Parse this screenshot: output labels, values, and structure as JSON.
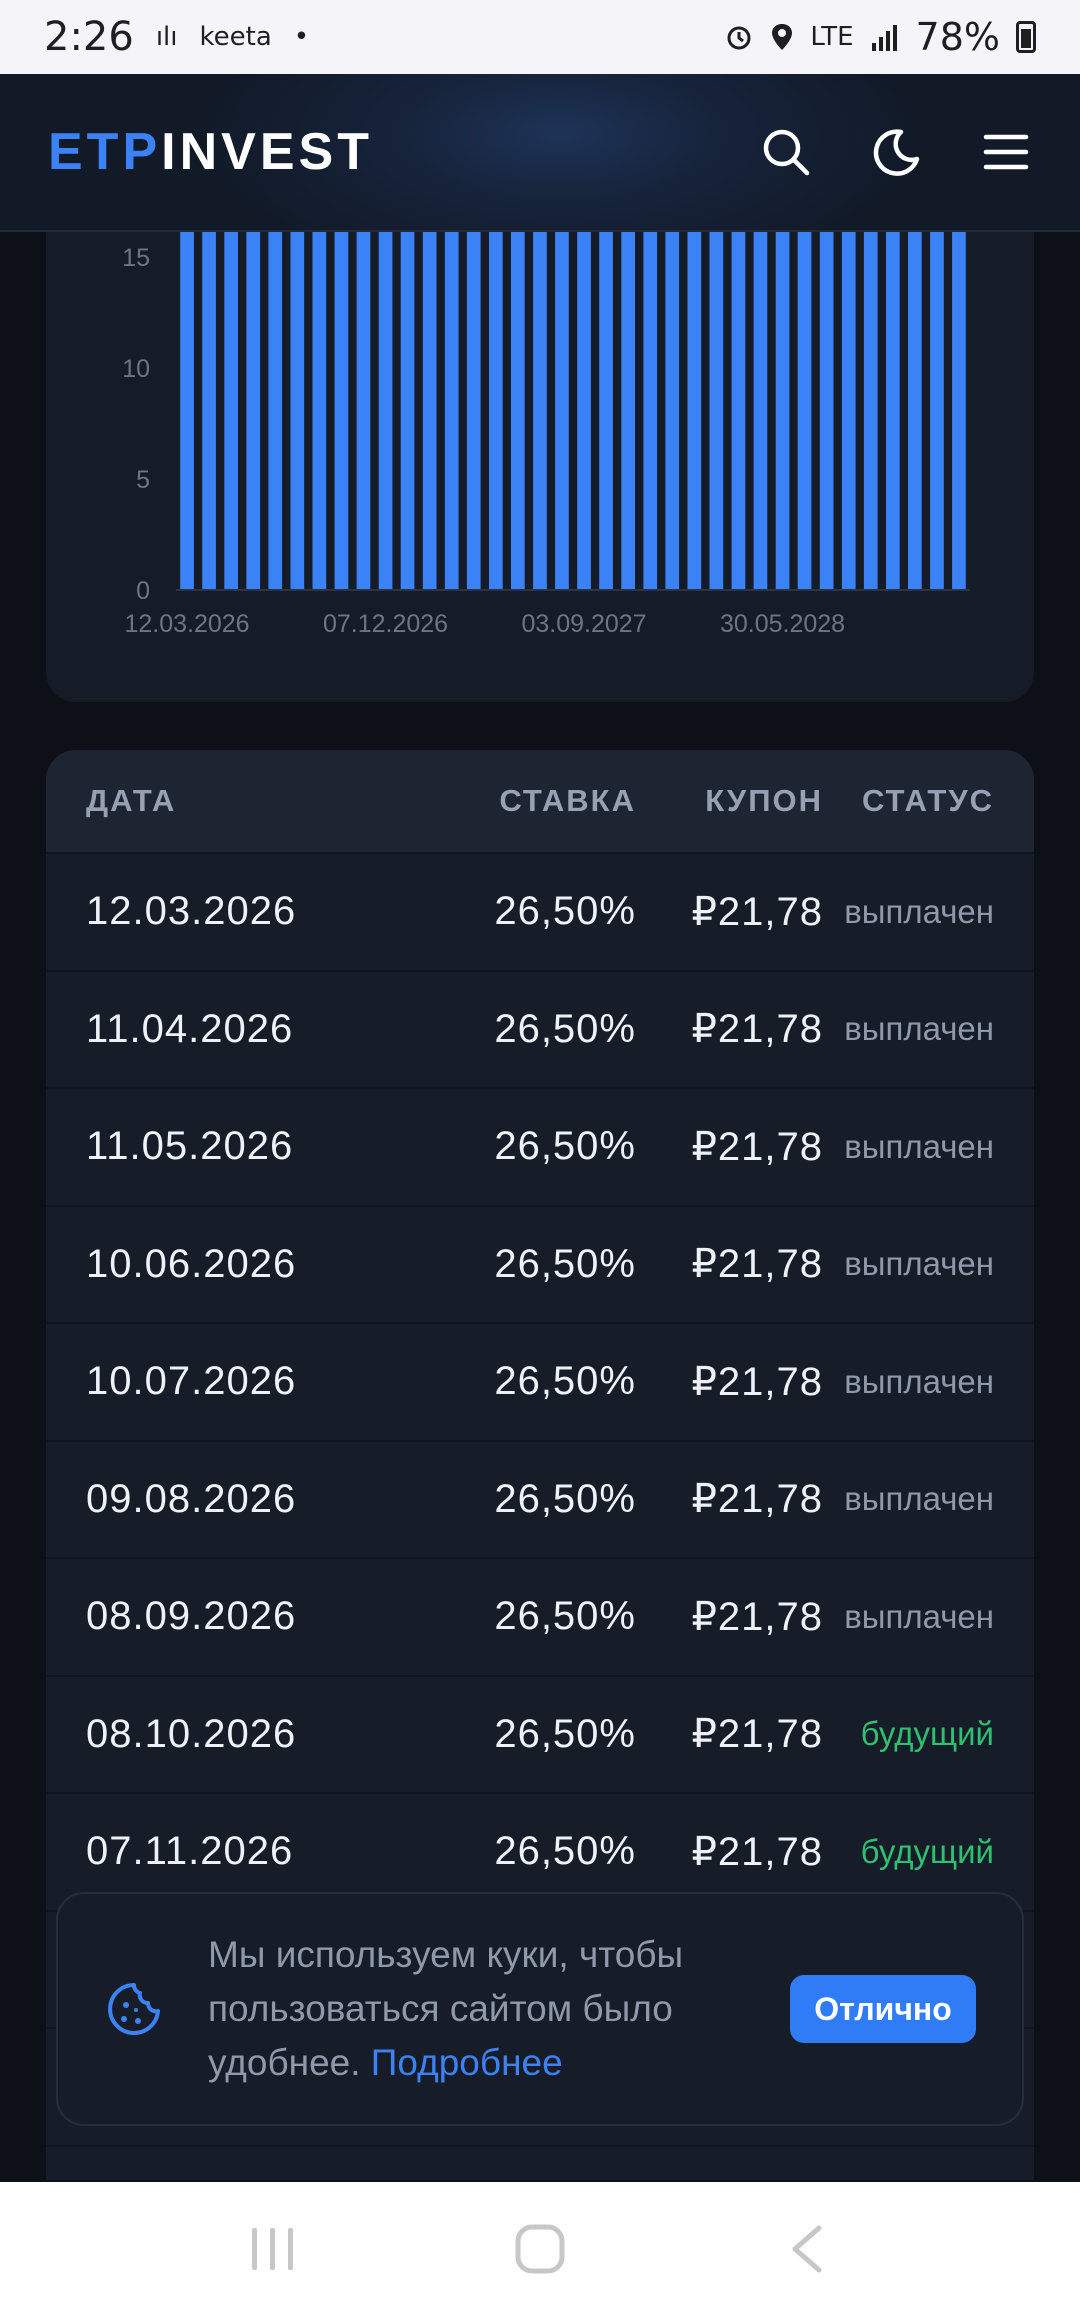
{
  "status_bar": {
    "time": "2:26",
    "left_glyphs": [
      "ılı",
      "keeta",
      "•"
    ],
    "network": "LTE",
    "battery_percent": "78%"
  },
  "header": {
    "logo_part1": "ETP",
    "logo_part2": "INVEST",
    "icons": [
      "search-icon",
      "moon-icon",
      "menu-icon"
    ]
  },
  "chart_data": {
    "type": "bar",
    "series_color": "#3b82f6",
    "values": [
      21.78,
      21.78,
      21.78,
      21.78,
      21.78,
      21.78,
      21.78,
      21.78,
      21.78,
      21.78,
      21.78,
      21.78,
      21.78,
      21.78,
      21.78,
      21.78,
      21.78,
      21.78,
      21.78,
      21.78,
      21.78,
      21.78,
      21.78,
      21.78,
      21.78,
      21.78,
      21.78,
      21.78,
      21.78,
      21.78,
      21.78,
      21.78,
      21.78,
      21.78,
      21.78,
      21.78
    ],
    "y_ticks": [
      "0",
      "5",
      "10",
      "15"
    ],
    "x_tick_labels": [
      "12.03.2026",
      "07.12.2026",
      "03.09.2027",
      "30.05.2028"
    ],
    "x_tick_every": 9,
    "ylim": [
      0,
      15
    ],
    "grid": false
  },
  "table": {
    "headers": {
      "date": "ДАТА",
      "rate": "СТАВКА",
      "coupon": "КУПОН",
      "status": "СТАТУС"
    },
    "rows": [
      {
        "date": "12.03.2026",
        "rate": "26,50%",
        "coupon": "₽21,78",
        "status": "выплачен",
        "future": false
      },
      {
        "date": "11.04.2026",
        "rate": "26,50%",
        "coupon": "₽21,78",
        "status": "выплачен",
        "future": false
      },
      {
        "date": "11.05.2026",
        "rate": "26,50%",
        "coupon": "₽21,78",
        "status": "выплачен",
        "future": false
      },
      {
        "date": "10.06.2026",
        "rate": "26,50%",
        "coupon": "₽21,78",
        "status": "выплачен",
        "future": false
      },
      {
        "date": "10.07.2026",
        "rate": "26,50%",
        "coupon": "₽21,78",
        "status": "выплачен",
        "future": false
      },
      {
        "date": "09.08.2026",
        "rate": "26,50%",
        "coupon": "₽21,78",
        "status": "выплачен",
        "future": false
      },
      {
        "date": "08.09.2026",
        "rate": "26,50%",
        "coupon": "₽21,78",
        "status": "выплачен",
        "future": false
      },
      {
        "date": "08.10.2026",
        "rate": "26,50%",
        "coupon": "₽21,78",
        "status": "будущий",
        "future": true
      },
      {
        "date": "07.11.2026",
        "rate": "26,50%",
        "coupon": "₽21,78",
        "status": "будущий",
        "future": true
      }
    ]
  },
  "cookie_banner": {
    "text": "Мы используем куки, чтобы пользоваться сайтом было удобнее.",
    "link": "Подробнее",
    "button": "Отлично"
  },
  "colors": {
    "accent": "#3b82f6",
    "status_paid": "#8f99aa",
    "status_future": "#2fbf71"
  }
}
